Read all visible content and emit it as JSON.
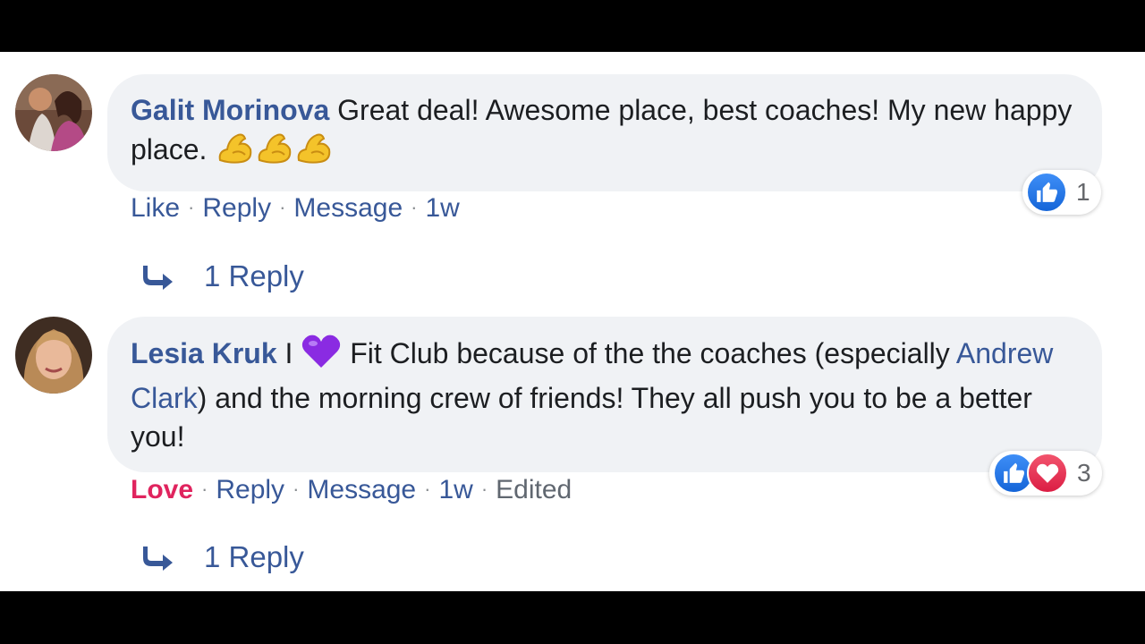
{
  "comments": [
    {
      "author": "Galit Morinova",
      "text_part1": " Great deal! Awesome place, best coaches! My new happy place. ",
      "emoji": [
        "flexed-biceps-emoji",
        "flexed-biceps-emoji",
        "flexed-biceps-emoji"
      ],
      "actions": {
        "reaction_label": "Like",
        "reply": "Reply",
        "message": "Message",
        "time": "1w"
      },
      "reactions": {
        "types": [
          "like"
        ],
        "count": "1"
      },
      "replies_label": "1 Reply"
    },
    {
      "author": "Lesia Kruk",
      "text_before_emoji": " I ",
      "emoji": "purple-heart-emoji",
      "text_after_emoji": " Fit Club because of the the coaches (especially ",
      "mention": "Andrew Clark",
      "text_end": ") and the morning crew of friends! They all push you to be a better you!",
      "actions": {
        "reaction_label": "Love",
        "reply": "Reply",
        "message": "Message",
        "time": "1w",
        "edited": "Edited"
      },
      "reactions": {
        "types": [
          "like",
          "love"
        ],
        "count": "3"
      },
      "replies_label": "1 Reply"
    }
  ],
  "colors": {
    "link": "#385898",
    "love": "#e0245e",
    "bubble": "#f0f2f5",
    "like_icon": "#1877f2"
  },
  "icons": {
    "reply_arrow": "reply-arrow-icon",
    "like": "thumbs-up-icon",
    "love": "heart-icon"
  }
}
